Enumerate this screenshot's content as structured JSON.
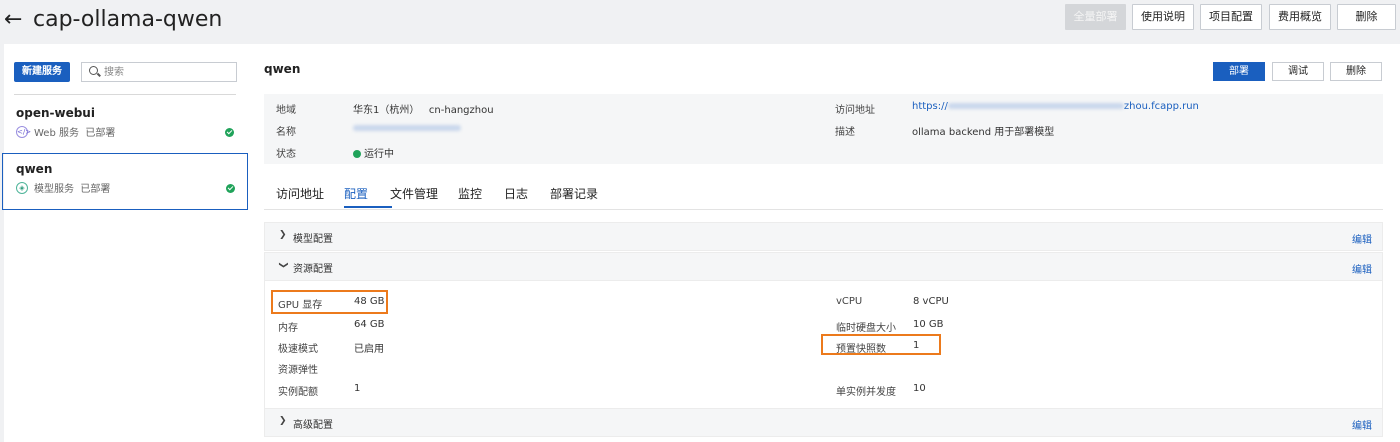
{
  "header": {
    "title": "cap-ollama-qwen",
    "buttons": {
      "deploy_all": "全量部署",
      "instructions": "使用说明",
      "project_config": "项目配置",
      "cost_overview": "费用概览",
      "delete": "删除"
    }
  },
  "sidebar": {
    "new_service": "新建服务",
    "search_placeholder": "搜索",
    "services": [
      {
        "name": "open-webui",
        "type": "Web 服务",
        "status": "已部署"
      },
      {
        "name": "qwen",
        "type": "模型服务",
        "status": "已部署"
      }
    ]
  },
  "main": {
    "service_name": "qwen",
    "actions": {
      "deploy": "部署",
      "debug": "调试",
      "delete": "删除"
    },
    "info": {
      "region_label": "地域",
      "region_value": "华东1（杭州）",
      "region_code": "cn-hangzhou",
      "name_label": "名称",
      "status_label": "状态",
      "status_value": "运行中",
      "url_label": "访问地址",
      "url_prefix": "https://",
      "url_suffix": "zhou.fcapp.run",
      "desc_label": "描述",
      "desc_value": "ollama backend 用于部署模型"
    },
    "tabs": [
      "访问地址",
      "配置",
      "文件管理",
      "监控",
      "日志",
      "部署记录"
    ],
    "active_tab": "配置",
    "sections": {
      "model_config": "模型配置",
      "resource_config": "资源配置",
      "advanced_config": "高级配置",
      "edit": "编辑"
    },
    "resources": {
      "gpu_mem_label": "GPU 显存",
      "gpu_mem_value": "48 GB",
      "memory_label": "内存",
      "memory_value": "64 GB",
      "fast_mode_label": "极速模式",
      "fast_mode_value": "已启用",
      "elastic_label": "资源弹性",
      "instance_label": "实例配额",
      "instance_value": "1",
      "vcpu_label": "vCPU",
      "vcpu_value": "8 vCPU",
      "disk_label": "临时硬盘大小",
      "disk_value": "10 GB",
      "snapshot_label": "预置快照数",
      "snapshot_value": "1",
      "concurrency_label": "单实例并发度",
      "concurrency_value": "10"
    }
  },
  "colors": {
    "accent": "#1a5fbf",
    "highlight": "#ec7a1c",
    "status_green": "#20a35a"
  }
}
